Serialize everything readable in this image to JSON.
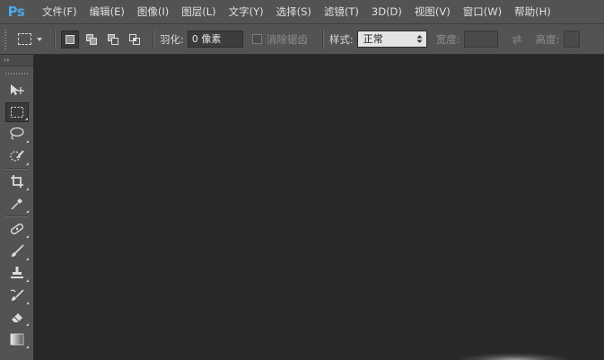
{
  "app": {
    "logo": "Ps"
  },
  "menu": [
    "文件(F)",
    "编辑(E)",
    "图像(I)",
    "图层(L)",
    "文字(Y)",
    "选择(S)",
    "滤镜(T)",
    "3D(D)",
    "视图(V)",
    "窗口(W)",
    "帮助(H)"
  ],
  "options": {
    "feather_label": "羽化:",
    "feather_value": "0 像素",
    "antialias_label": "消除锯齿",
    "style_label": "样式:",
    "style_value": "正常",
    "width_label": "宽度:",
    "height_label": "高度:"
  },
  "toolbar": {
    "collapse_glyph": "››",
    "tools": [
      "move-tool",
      "rectangular-marquee-tool",
      "lasso-tool",
      "quick-selection-tool",
      "crop-tool",
      "eyedropper-tool",
      "spot-healing-brush-tool",
      "brush-tool",
      "clone-stamp-tool",
      "history-brush-tool",
      "eraser-tool",
      "gradient-tool"
    ],
    "active_tool": "rectangular-marquee-tool"
  },
  "colors": {
    "chrome": "#535353",
    "canvas": "#282828",
    "logo": "#4aa8ea"
  }
}
